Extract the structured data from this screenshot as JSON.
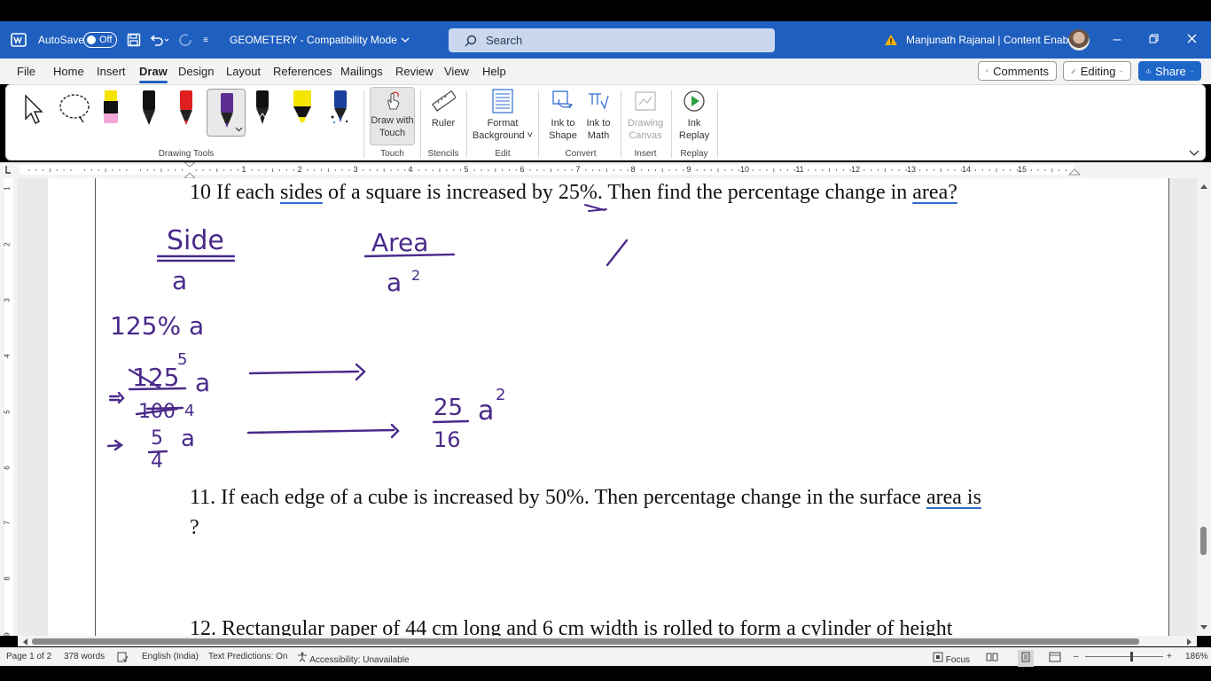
{
  "titlebar": {
    "autosave_label": "AutoSave",
    "autosave_state": "Off",
    "doc_title": "GEOMETERY - Compatibility Mode",
    "search_placeholder": "Search",
    "user_name": "Manjunath Rajanal | Content Enablers"
  },
  "menu": {
    "tabs": [
      "File",
      "Home",
      "Insert",
      "Draw",
      "Design",
      "Layout",
      "References",
      "Mailings",
      "Review",
      "View",
      "Help"
    ],
    "active_tab": "Draw",
    "comments_label": "Comments",
    "editing_label": "Editing",
    "share_label": "Share"
  },
  "ribbon": {
    "groups": {
      "drawing_tools": "Drawing Tools",
      "touch": "Touch",
      "stencils": "Stencils",
      "edit": "Edit",
      "convert": "Convert",
      "insert": "Insert",
      "replay": "Replay"
    },
    "buttons": {
      "draw_with_touch": [
        "Draw with",
        "Touch"
      ],
      "ruler": [
        "Ruler"
      ],
      "format_background": [
        "Format",
        "Background ˅"
      ],
      "ink_to_shape": [
        "Ink to",
        "Shape"
      ],
      "ink_to_math": [
        "Ink to",
        "Math"
      ],
      "drawing_canvas": [
        "Drawing",
        "Canvas"
      ],
      "ink_replay": [
        "Ink",
        "Replay"
      ]
    },
    "pen_colors": [
      "#f4c9a0",
      "#111111",
      "#e02020",
      "#5b2c91",
      "#111111",
      "#f5e400",
      "#1a3f9a"
    ]
  },
  "ruler": {
    "numbers": [
      "1",
      "1",
      "2",
      "3",
      "4",
      "5",
      "6",
      "7",
      "8",
      "9",
      "10",
      "11",
      "12",
      "13",
      "14",
      "15"
    ],
    "vertical_numbers": [
      "1",
      "2",
      "3",
      "4",
      "5",
      "6",
      "7",
      "8",
      "9"
    ]
  },
  "document": {
    "q10": {
      "prefix": "10 If each ",
      "w1": "sides",
      "mid1": " of a square is increased by ",
      "w2": "25%",
      "mid2": ". Then find the percentage change in ",
      "w3": "area?"
    },
    "q11": {
      "line1_prefix": "11. If each edge of a cube is increased by 50%. Then percentage change in the surface ",
      "line1_ul": "area  is",
      "line2": "?"
    },
    "q12_partial": "12. Rectangular paper of 44 cm long and 6 cm width is rolled to form a cylinder of height",
    "ink": {
      "side_label": "Side",
      "area_label": "Area",
      "a": "a",
      "a_sq_base": "a",
      "sq_exp": "2",
      "line_125": "125% a",
      "frac1_num": "125",
      "frac1_num_over": "5",
      "frac1_den": "100",
      "frac1_den_over": "4",
      "frac2_num": "5",
      "frac2_den": "4",
      "result_num": "25",
      "result_den": "16",
      "result_var": "a",
      "result_exp": "2",
      "ink_color": "#4a2a8a"
    }
  },
  "status": {
    "page": "Page 1 of 2",
    "words": "378 words",
    "language": "English (India)",
    "text_predictions": "Text Predictions: On",
    "accessibility": "Accessibility: Unavailable",
    "focus": "Focus",
    "zoom": "186%"
  }
}
